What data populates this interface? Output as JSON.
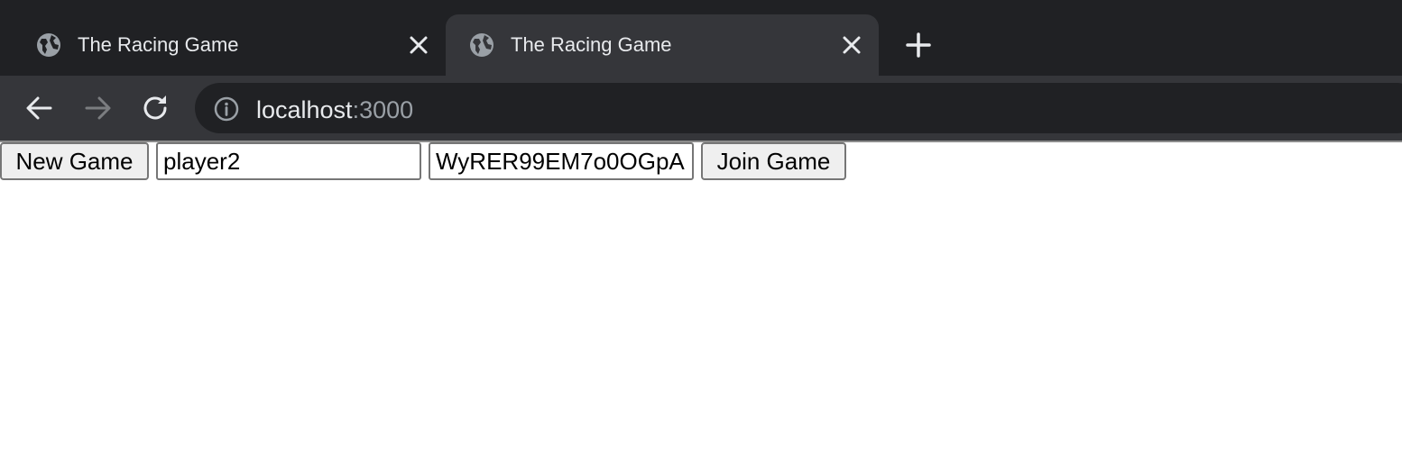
{
  "browser": {
    "tabs": [
      {
        "title": "The Racing Game",
        "active": false
      },
      {
        "title": "The Racing Game",
        "active": true
      }
    ],
    "address": {
      "host": "localhost",
      "port": ":3000"
    }
  },
  "page": {
    "new_game_label": "New Game",
    "player_name_value": "player2",
    "game_id_value": "WyRER99EM7o0OGpA",
    "join_game_label": "Join Game"
  },
  "colors": {
    "chrome_dark": "#202124",
    "chrome_mid": "#35363a",
    "text_light": "#e8eaed",
    "text_dim": "#9aa0a6"
  },
  "icons": [
    "globe-icon",
    "close-icon",
    "plus-icon",
    "back-arrow-icon",
    "forward-arrow-icon",
    "reload-icon",
    "info-icon"
  ]
}
